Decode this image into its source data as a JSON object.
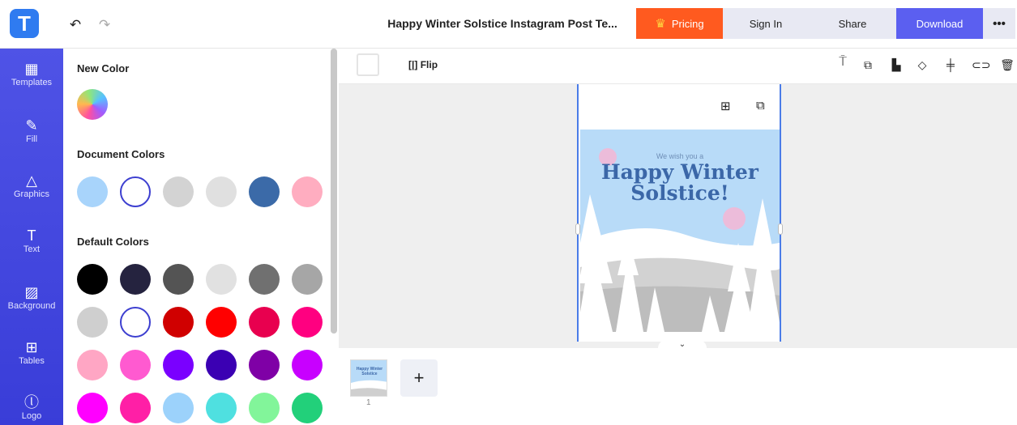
{
  "header": {
    "logo_letter": "T",
    "undo_icon": "↶",
    "redo_icon": "↷",
    "doc_title": "Happy Winter Solstice Instagram Post Te...",
    "pricing": "Pricing",
    "sign_in": "Sign In",
    "share": "Share",
    "download": "Download",
    "more": "•••"
  },
  "rail": [
    {
      "label": "Templates",
      "icon": "▦"
    },
    {
      "label": "Fill",
      "icon": "✎"
    },
    {
      "label": "Graphics",
      "icon": "△"
    },
    {
      "label": "Text",
      "icon": "T"
    },
    {
      "label": "Background",
      "icon": "▨"
    },
    {
      "label": "Tables",
      "icon": "⊞"
    },
    {
      "label": "Logo",
      "icon": "ⓛ"
    }
  ],
  "panel": {
    "new_color": "New Color",
    "document_colors": "Document Colors",
    "default_colors": "Default Colors"
  },
  "document_colors": [
    "#a8d4fb",
    "#ffffff",
    "#d3d3d3",
    "#e0e0e0",
    "#3b6aa8",
    "#ffadc0"
  ],
  "default_colors": [
    "#000000",
    "#25233f",
    "#545454",
    "#e1e1e1",
    "#707070",
    "#a6a6a6",
    "#cfcfcf",
    "#ffffff",
    "#d00000",
    "#ff0000",
    "#e8004f",
    "#ff0080",
    "#ffa6c4",
    "#ff5ad0",
    "#7a00ff",
    "#3b00b3",
    "#7f00a6",
    "#c800ff",
    "#ff00ff",
    "#ff1fa6",
    "#9cd2fb",
    "#4fe0e0",
    "#82f59a",
    "#22d07a"
  ],
  "toolbar": {
    "flip": "Flip",
    "icons": [
      "paint-roller-icon",
      "copy-style-icon",
      "arrange-icon",
      "opacity-icon",
      "align-icon",
      "link-icon",
      "delete-icon"
    ]
  },
  "poster": {
    "subtitle": "We wish you a",
    "title_line1": "Happy Winter",
    "title_line2": "Solstice!"
  },
  "pages": {
    "page_number": "1",
    "thumb_title": "Happy Winter Solstice",
    "add": "+",
    "collapse": "⌄"
  }
}
